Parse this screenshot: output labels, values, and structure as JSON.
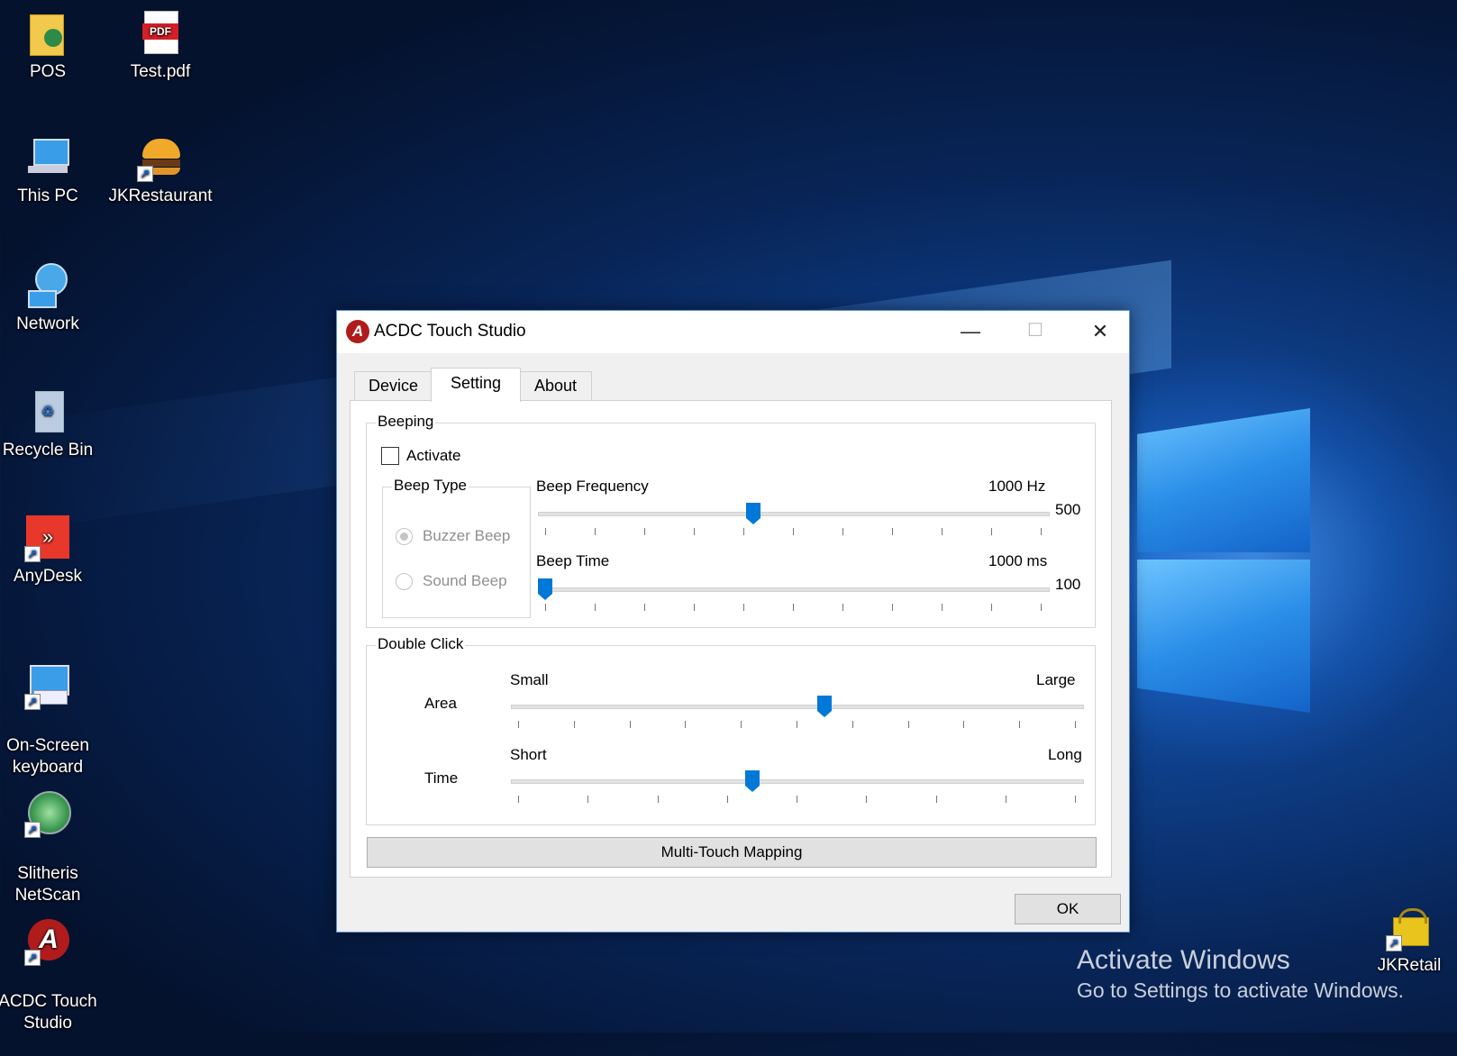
{
  "desktop": {
    "icons": [
      {
        "label": "POS"
      },
      {
        "label": "Test.pdf",
        "badge": "PDF"
      },
      {
        "label": "This PC"
      },
      {
        "label": "JKRestaurant"
      },
      {
        "label": "Network"
      },
      {
        "label": "Recycle Bin"
      },
      {
        "label": "AnyDesk"
      },
      {
        "label": "On-Screen\nkeyboard"
      },
      {
        "label": "Slitheris\nNetScan"
      },
      {
        "label": "ACDC Touch\nStudio"
      },
      {
        "label": "JKRetail"
      }
    ],
    "watermark": {
      "title": "Activate Windows",
      "subtitle": "Go to Settings to activate Windows."
    }
  },
  "dialog": {
    "title": "ACDC Touch Studio",
    "controls": {
      "minimize": "—",
      "maximize": "☐",
      "close": "✕"
    },
    "tabs": [
      {
        "label": "Device"
      },
      {
        "label": "Setting",
        "active": true
      },
      {
        "label": "About"
      }
    ],
    "beeping": {
      "group_label": "Beeping",
      "activate_label": "Activate",
      "activate_checked": false,
      "beep_type": {
        "group_label": "Beep Type",
        "options": [
          "Buzzer Beep",
          "Sound Beep"
        ],
        "selected": "Buzzer Beep",
        "enabled": false
      },
      "frequency": {
        "label": "Beep Frequency",
        "max_label": "1000 Hz",
        "min_label": "500",
        "position": 0.42
      },
      "time": {
        "label": "Beep Time",
        "max_label": "1000 ms",
        "min_label": "100",
        "position": 0.0
      }
    },
    "double_click": {
      "group_label": "Double Click",
      "area": {
        "label": "Area",
        "min_label": "Small",
        "max_label": "Large",
        "position": 0.55
      },
      "time": {
        "label": "Time",
        "min_label": "Short",
        "max_label": "Long",
        "position": 0.42
      }
    },
    "multitouch_button": "Multi-Touch Mapping",
    "ok_button": "OK"
  }
}
